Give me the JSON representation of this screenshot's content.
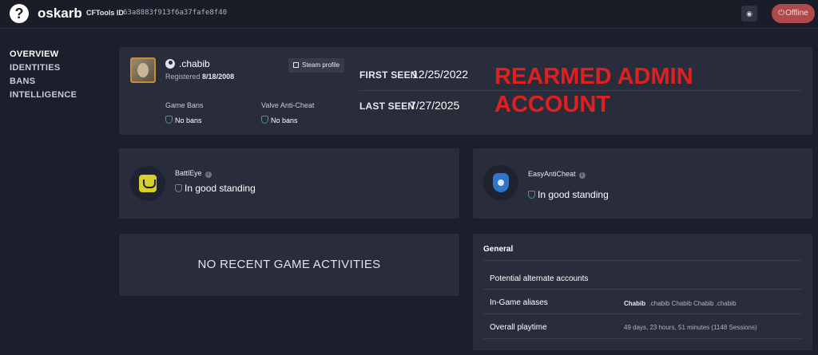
{
  "header": {
    "logo_glyph": "?",
    "username": "oskarb",
    "cftools_label": "CFTools ID",
    "cftools_id": "63a8883f913f6a37fafe8f40",
    "eye_icon": "eye-icon",
    "status_button": "Offline",
    "status_color": "#b04a4a"
  },
  "sidebar": {
    "items": [
      {
        "label": "OVERVIEW",
        "active": true
      },
      {
        "label": "IDENTITIES",
        "active": false
      },
      {
        "label": "BANS",
        "active": false
      },
      {
        "label": "INTELLIGENCE",
        "active": false
      }
    ]
  },
  "profile": {
    "steam_name": ".chabib",
    "registered_label": "Registered",
    "registered_date": "8/18/2008",
    "steam_profile_button": "Steam profile",
    "game_bans_label": "Game Bans",
    "game_bans_value": "No bans",
    "vac_label": "Valve Anti-Cheat",
    "vac_value": "No bans",
    "first_seen_label": "FIRST SEEN",
    "first_seen_value": "12/25/2022",
    "last_seen_label": "LAST SEEN",
    "last_seen_value": "7/27/2025",
    "overlay_line1": "REARMED ADMIN",
    "overlay_line2": "ACCOUNT",
    "overlay_color": "#e02020"
  },
  "anticheat": {
    "battleye": {
      "name": "BattlEye",
      "status": "In good standing"
    },
    "eac": {
      "name": "EasyAntiCheat",
      "status": "In good standing"
    },
    "good_color": "#3aa865"
  },
  "activities": {
    "empty_text": "NO RECENT GAME ACTIVITIES"
  },
  "general": {
    "title": "General",
    "alt_accounts_label": "Potential alternate accounts",
    "aliases_label": "In-Game aliases",
    "aliases_primary": "Chabib",
    "aliases_rest": ".chabib  Chabib  Chabib  .chabib",
    "playtime_label": "Overall playtime",
    "playtime_value": "49 days, 23 hours, 51 minutes (1148 Sessions)"
  }
}
